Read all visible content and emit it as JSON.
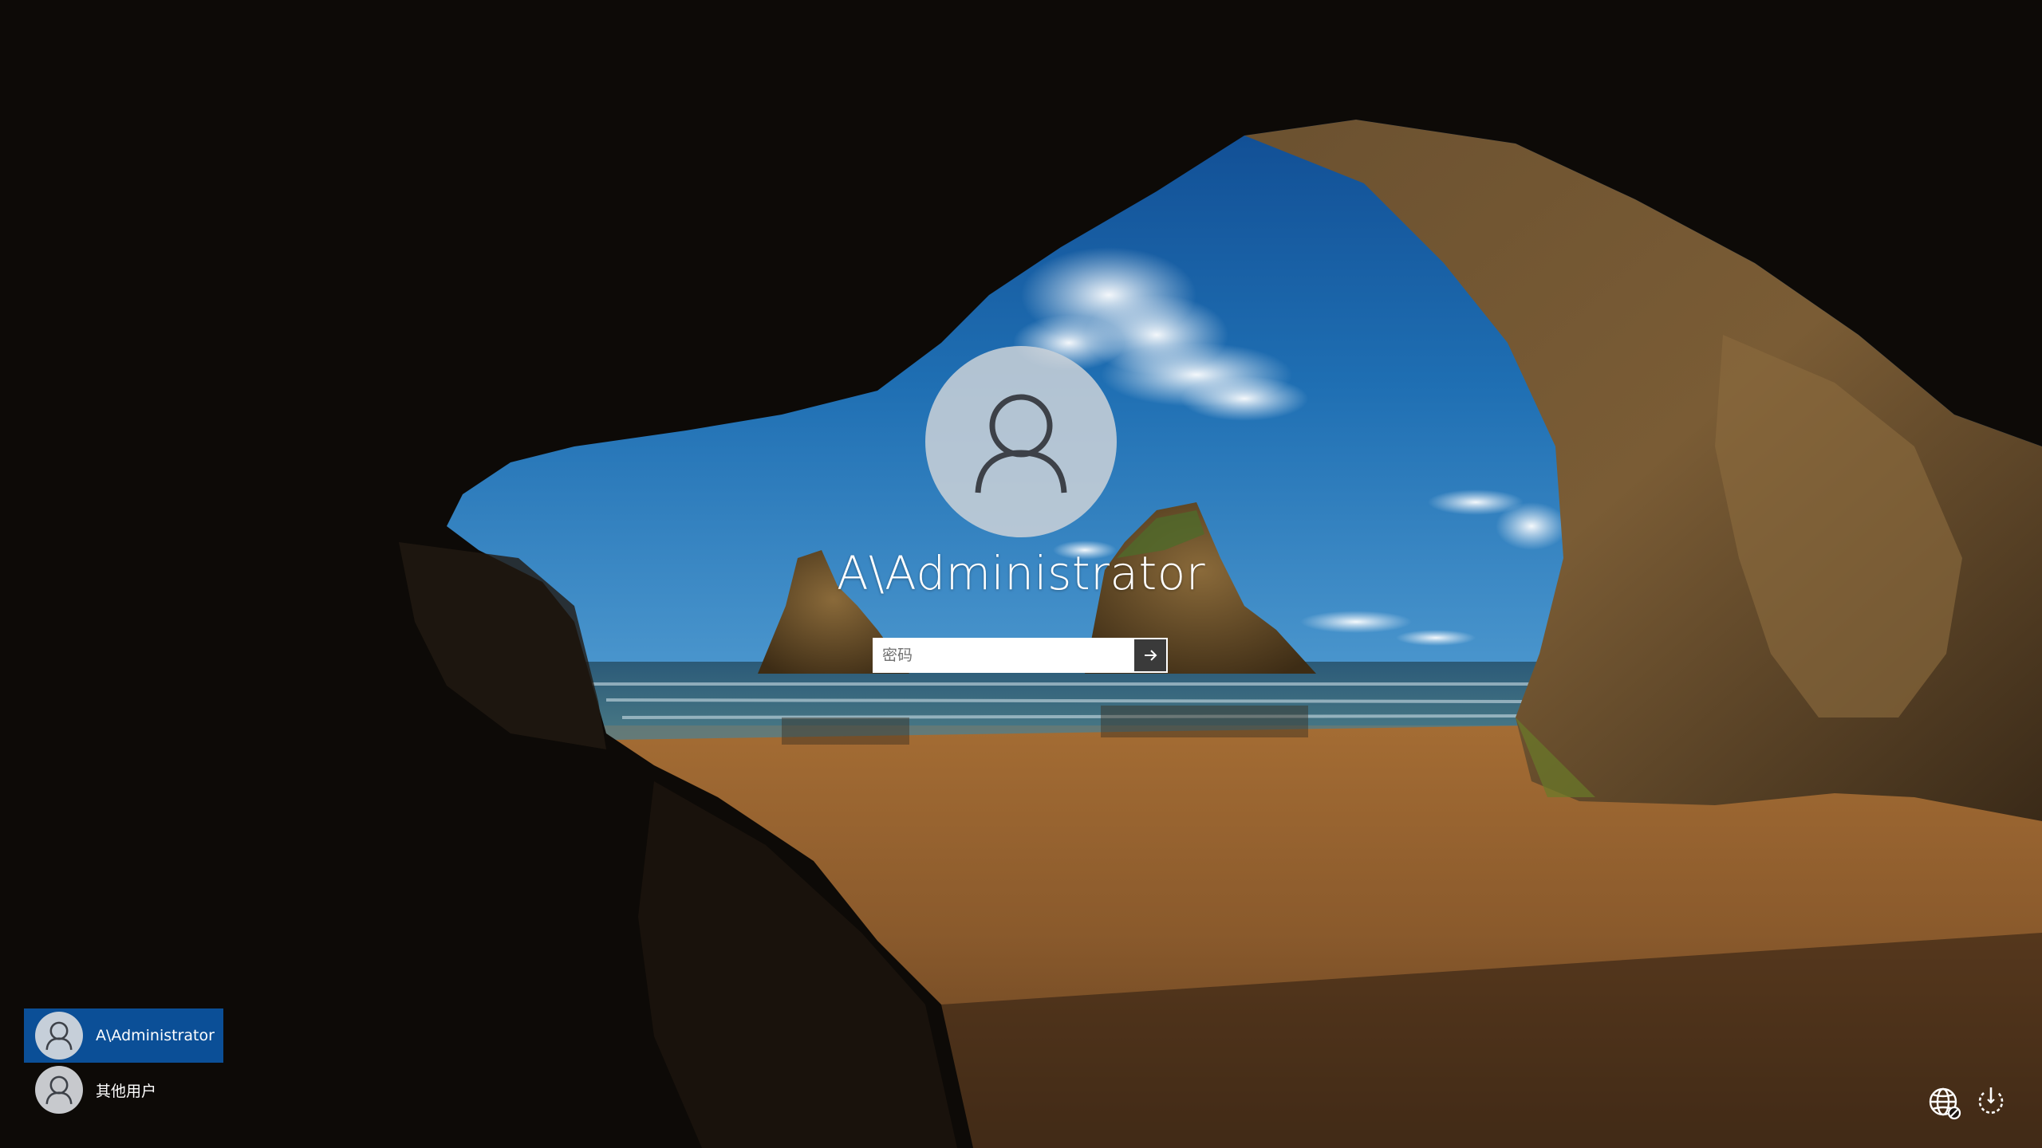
{
  "login": {
    "username": "A\\Administrator",
    "password_placeholder": "密码",
    "password_value": ""
  },
  "user_list": [
    {
      "label": "A\\Administrator",
      "selected": true
    },
    {
      "label": "其他用户",
      "selected": false
    }
  ],
  "icons": {
    "large_avatar": "user-icon",
    "submit": "arrow-right-icon",
    "network": "globe-no-connection-icon",
    "power": "power-icon"
  },
  "colors": {
    "selected_user_tile": "#0b4f97",
    "avatar_fill": "#cdd2d8",
    "submit_button_bg": "#3a3a3a"
  }
}
